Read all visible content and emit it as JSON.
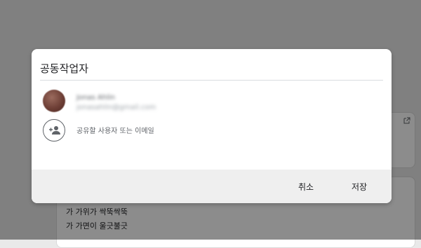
{
  "background": {
    "lines": [
      "가 가위가 싹뚝싹뚝",
      "가 가면이 울긋불긋"
    ]
  },
  "dialog": {
    "title": "공동작업자",
    "collaborator": {
      "name": "Jonas Ahlin",
      "email": "jonasahlin@gmail.com"
    },
    "share_input": {
      "placeholder": "공유할 사용자 또는 이메일"
    },
    "buttons": {
      "cancel": "취소",
      "save": "저장"
    }
  },
  "icons": {
    "add_person": "person-add-icon",
    "external_link": "open-in-new-icon"
  }
}
